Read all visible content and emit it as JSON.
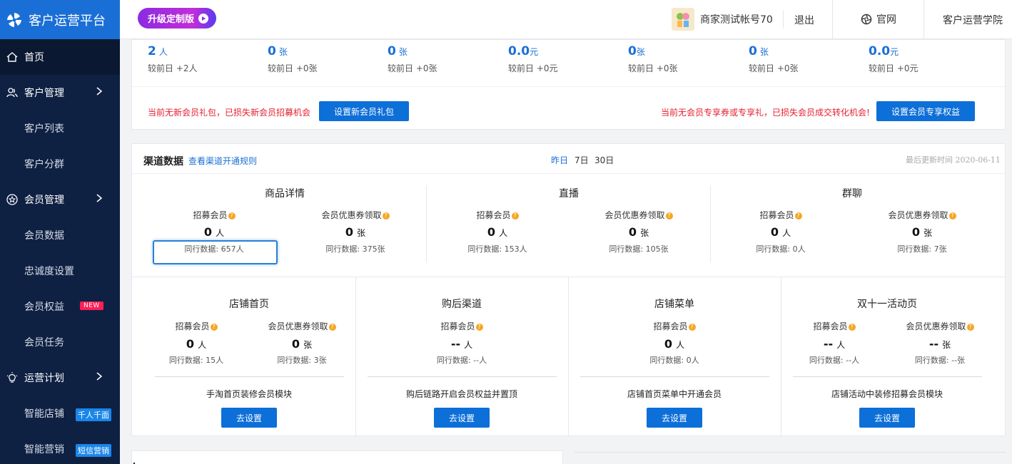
{
  "app": {
    "title": "客户运营平台"
  },
  "sidebar": {
    "home": "首页",
    "customer_mgmt": "客户管理",
    "customer_list": "客户列表",
    "customer_group": "客户分群",
    "member_mgmt": "会员管理",
    "member_data": "会员数据",
    "loyalty": "忠诚度设置",
    "member_rights": "会员权益",
    "new_badge": "NEW",
    "member_tasks": "会员任务",
    "ops_plan": "运营计划",
    "smart_store": "智能店铺",
    "smart_store_badge": "千人千面",
    "smart_marketing": "智能营销",
    "smart_marketing_badge": "短信营销"
  },
  "topbar": {
    "upgrade": "升级定制版",
    "account": "商家测试帐号70",
    "logout": "退出",
    "site": "官网",
    "academy": "客户运营学院"
  },
  "stats": [
    {
      "value": "2",
      "unit": "人",
      "sub": "较前日 +2人"
    },
    {
      "value": "0",
      "unit": "张",
      "sub": "较前日 +0张"
    },
    {
      "value": "0",
      "unit": "张",
      "sub": "较前日 +0张"
    },
    {
      "value": "0.0",
      "unit": "元",
      "sub": "较前日 +0元"
    },
    {
      "value": "0",
      "unit": "张",
      "sub": "较前日 +0张"
    },
    {
      "value": "0",
      "unit": "张",
      "sub": "较前日 +0张"
    },
    {
      "value": "0.0",
      "unit": "元",
      "sub": "较前日 +0元"
    }
  ],
  "alerts": {
    "left_text": "当前无新会员礼包，已损失新会员招募机会",
    "left_button": "设置新会员礼包",
    "right_text": "当前无会员专享券或专享礼，已损失会员成交转化机会!",
    "right_button": "设置会员专享权益"
  },
  "channel": {
    "title": "渠道数据",
    "link": "查看渠道开通规则",
    "periods": [
      "昨日",
      "7日",
      "30日"
    ],
    "updated": "最后更新时间 2020-06-11",
    "recruit_label": "招募会员",
    "coupon_label": "会员优惠券领取",
    "top_groups": [
      {
        "title": "商品详情",
        "recruit": "0",
        "recruit_unit": "人",
        "recruit_peer": "同行数据: 657人",
        "coupon": "0",
        "coupon_unit": "张",
        "coupon_peer": "同行数据: 375张"
      },
      {
        "title": "直播",
        "recruit": "0",
        "recruit_unit": "人",
        "recruit_peer": "同行数据: 153人",
        "coupon": "0",
        "coupon_unit": "张",
        "coupon_peer": "同行数据: 105张"
      },
      {
        "title": "群聊",
        "recruit": "0",
        "recruit_unit": "人",
        "recruit_peer": "同行数据: 0人",
        "coupon": "0",
        "coupon_unit": "张",
        "coupon_peer": "同行数据: 7张"
      }
    ],
    "bottom_groups": [
      {
        "title": "店铺首页",
        "recruit": "0",
        "recruit_unit": "人",
        "recruit_peer": "同行数据: 15人",
        "coupon": "0",
        "coupon_unit": "张",
        "coupon_peer": "同行数据: 3张",
        "desc": "手淘首页装修会员模块",
        "button": "去设置"
      },
      {
        "title": "购后渠道",
        "recruit": "--",
        "recruit_unit": "人",
        "recruit_peer": "同行数据: --人",
        "desc": "购后链路开启会员权益并置顶",
        "button": "去设置"
      },
      {
        "title": "店铺菜单",
        "recruit": "0",
        "recruit_unit": "人",
        "recruit_peer": "同行数据: 0人",
        "desc": "店铺首页菜单中开通会员",
        "button": "去设置"
      },
      {
        "title": "双十一活动页",
        "recruit": "--",
        "recruit_unit": "人",
        "recruit_peer": "同行数据: --人",
        "coupon": "--",
        "coupon_unit": "张",
        "coupon_peer": "同行数据: --张",
        "desc": "店铺活动中装修招募会员模块",
        "button": "去设置"
      }
    ]
  },
  "colors": {
    "accent": "#1a6fd6",
    "sidebar": "#0f2143",
    "warn": "#e5202e"
  }
}
